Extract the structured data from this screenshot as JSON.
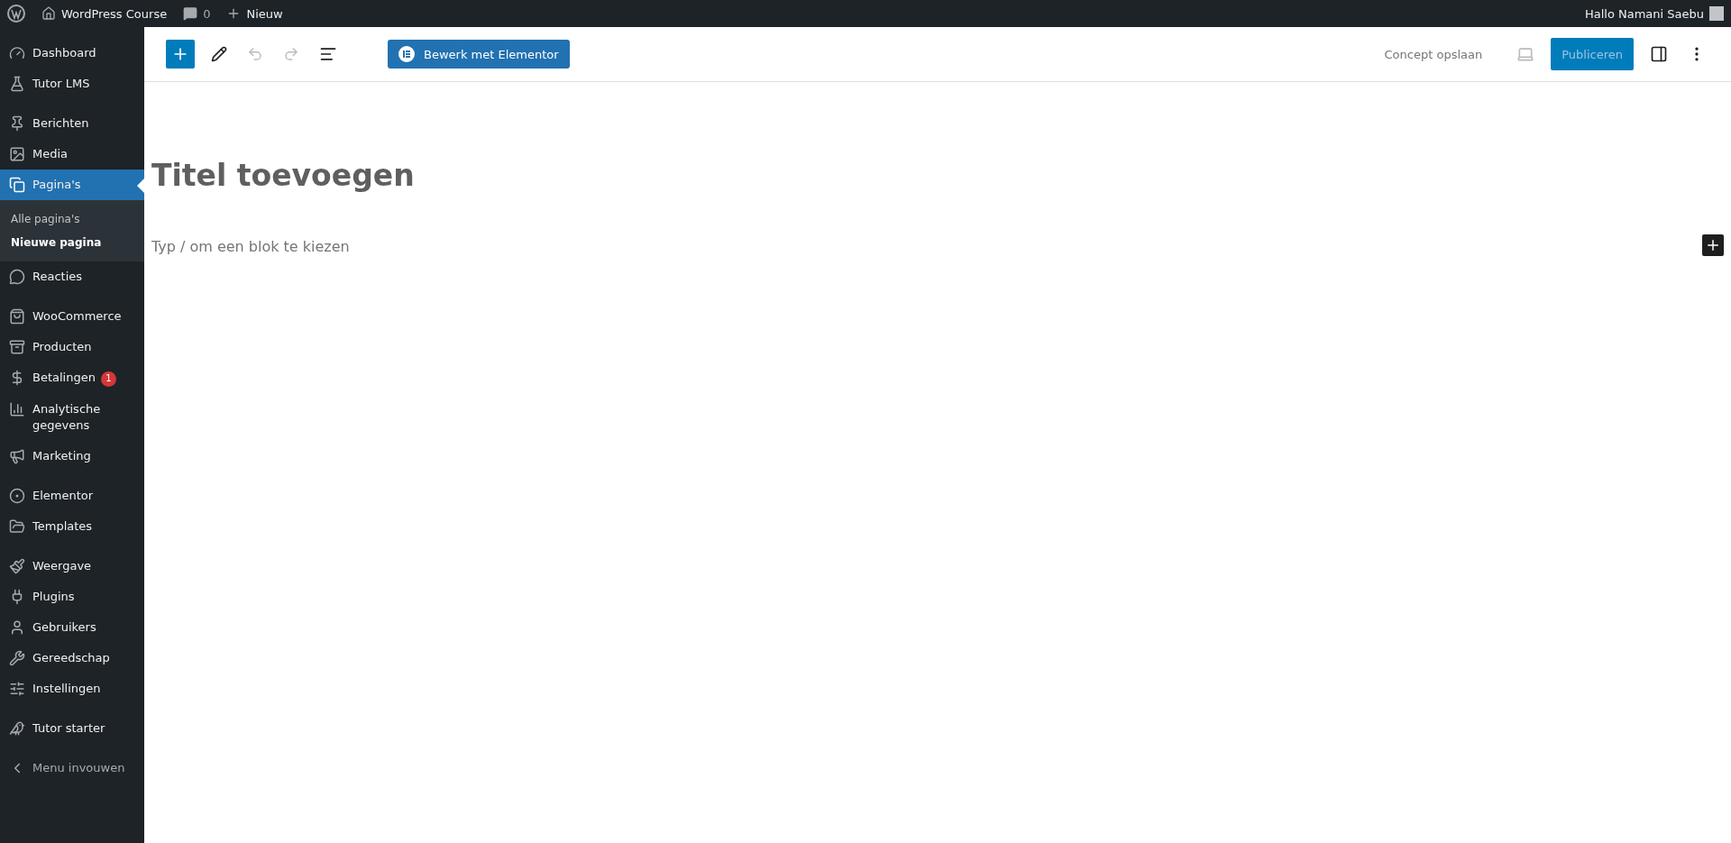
{
  "admin_bar": {
    "site": "WordPress Course",
    "comments": "0",
    "new": "Nieuw",
    "greeting": "Hallo Namani Saebu"
  },
  "sidebar": {
    "groups": [
      [
        {
          "label": "Dashboard",
          "selected": false
        },
        {
          "label": "Tutor LMS",
          "selected": false
        }
      ],
      [
        {
          "label": "Berichten",
          "selected": false
        },
        {
          "label": "Media",
          "selected": false
        },
        {
          "label": "Pagina's",
          "selected": true,
          "submenu": [
            {
              "label": "Alle pagina's",
              "selected": false
            },
            {
              "label": "Nieuwe pagina",
              "selected": true
            }
          ]
        },
        {
          "label": "Reacties",
          "selected": false
        }
      ],
      [
        {
          "label": "WooCommerce",
          "selected": false
        },
        {
          "label": "Producten",
          "selected": false
        },
        {
          "label": "Betalingen",
          "selected": false,
          "badge": "1"
        },
        {
          "label": "Analytische gegevens",
          "selected": false
        },
        {
          "label": "Marketing",
          "selected": false
        }
      ],
      [
        {
          "label": "Elementor",
          "selected": false
        },
        {
          "label": "Templates",
          "selected": false
        }
      ],
      [
        {
          "label": "Weergave",
          "selected": false
        },
        {
          "label": "Plugins",
          "selected": false
        },
        {
          "label": "Gebruikers",
          "selected": false
        },
        {
          "label": "Gereedschap",
          "selected": false
        },
        {
          "label": "Instellingen",
          "selected": false
        }
      ],
      [
        {
          "label": "Tutor starter",
          "selected": false
        }
      ]
    ],
    "collapse": "Menu invouwen"
  },
  "toolbar": {
    "elementor_button": "Bewerk met Elementor",
    "save_draft": "Concept opslaan",
    "publish": "Publiceren"
  },
  "editor": {
    "title_placeholder": "Titel toevoegen",
    "block_placeholder": "Typ / om een blok te kiezen"
  }
}
